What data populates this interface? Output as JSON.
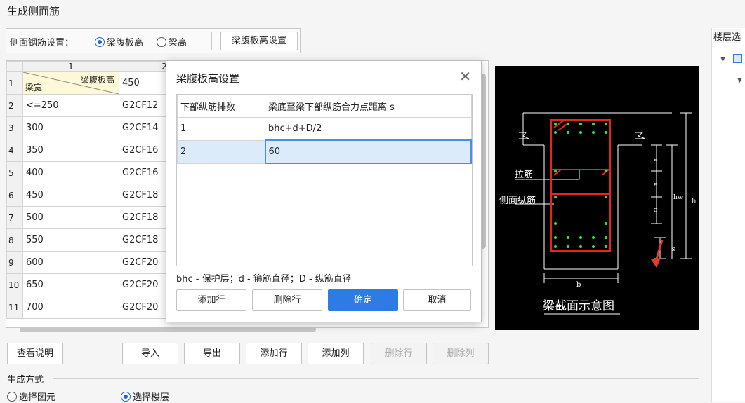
{
  "window": {
    "title": "生成侧面筋"
  },
  "settings": {
    "label": "侧面钢筋设置：",
    "options": [
      "梁腹板高",
      "梁高"
    ],
    "selected": "梁腹板高",
    "config_button": "梁腹板高设置"
  },
  "grid": {
    "col_headers": [
      "1",
      "2"
    ],
    "corner_top": "梁腹板高",
    "corner_bottom": "梁宽",
    "first_row_value": "450",
    "rows": [
      {
        "num": "2",
        "c1": "<=250",
        "c2": "G2CF12"
      },
      {
        "num": "3",
        "c1": "300",
        "c2": "G2CF14"
      },
      {
        "num": "4",
        "c1": "350",
        "c2": "G2CF16"
      },
      {
        "num": "5",
        "c1": "400",
        "c2": "G2CF16"
      },
      {
        "num": "6",
        "c1": "450",
        "c2": "G2CF18"
      },
      {
        "num": "7",
        "c1": "500",
        "c2": "G2CF18"
      },
      {
        "num": "8",
        "c1": "550",
        "c2": "G2CF18"
      },
      {
        "num": "9",
        "c1": "600",
        "c2": "G2CF20"
      },
      {
        "num": "10",
        "c1": "650",
        "c2": "G2CF20"
      },
      {
        "num": "11",
        "c1": "700",
        "c2": "G2CF20"
      }
    ]
  },
  "toolbar": {
    "help": "查看说明",
    "import": "导入",
    "export": "导出",
    "add_row": "添加行",
    "add_col": "添加列",
    "del_row": "删除行",
    "del_col": "删除列"
  },
  "generate": {
    "label": "生成方式",
    "options": [
      "选择图元",
      "选择楼层"
    ],
    "selected": "选择楼层"
  },
  "right_panel": {
    "title": "楼层选"
  },
  "diagram": {
    "caption": "梁截面示意图",
    "label_tie": "拉筋",
    "label_side": "侧面纵筋",
    "dim_a": "a",
    "dim_hw": "hw",
    "dim_h": "h",
    "dim_s": "s",
    "dim_b": "b"
  },
  "dialog": {
    "title": "梁腹板高设置",
    "col1": "下部纵筋排数",
    "col2": "梁底至梁下部纵筋合力点距离 s",
    "rows": [
      {
        "c1": "1",
        "c2": "bhc+d+D/2"
      },
      {
        "c1": "2",
        "c2": "60"
      }
    ],
    "note": "bhc - 保护层；d - 箍筋直径；D - 纵筋直径",
    "add_row": "添加行",
    "del_row": "删除行",
    "ok": "确定",
    "cancel": "取消"
  },
  "colors": {
    "accent": "#2d7be5",
    "annotation_arrow": "#e8382c",
    "selection": "#dcebfa"
  }
}
